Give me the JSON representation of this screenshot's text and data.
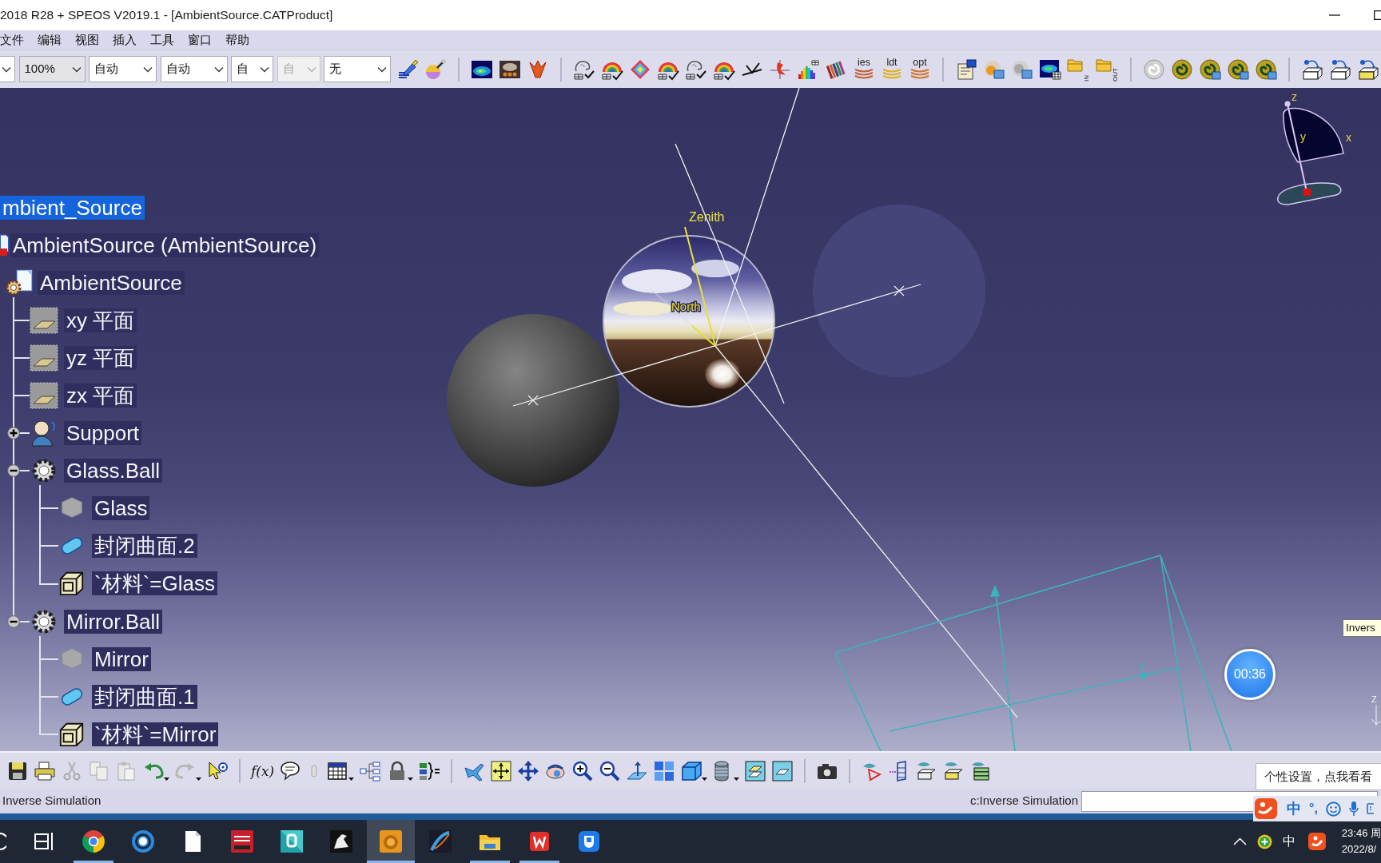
{
  "window": {
    "title": "2018 R28 + SPEOS V2019.1 - [AmbientSource.CATProduct]"
  },
  "menu": [
    "文件",
    "编辑",
    "视图",
    "插入",
    "工具",
    "窗口",
    "帮助"
  ],
  "toolbar": {
    "combos": [
      {
        "kind": "list",
        "disabled": false
      },
      {
        "kind": "editable",
        "value": "100%",
        "disabled": false
      },
      {
        "kind": "list",
        "value": "自动",
        "disabled": false
      },
      {
        "kind": "list",
        "value": "自动",
        "disabled": false
      },
      {
        "kind": "list",
        "value": "自",
        "disabled": false
      },
      {
        "kind": "list",
        "value": "自",
        "disabled": true
      },
      {
        "kind": "list",
        "value": "无",
        "disabled": false
      }
    ],
    "format_buttons": [
      {
        "label": "ies",
        "color": "#c4603a"
      },
      {
        "label": "ldt",
        "color": "#e0b020"
      },
      {
        "label": "opt",
        "color": "#d2762e"
      }
    ],
    "folder_buttons": [
      "IN",
      "OUT"
    ]
  },
  "tree": [
    {
      "label": "mbient_Source",
      "selected": true,
      "children": [
        {
          "label": "AmbientSource (AmbientSource)",
          "kind": "product",
          "selected": false,
          "children": [
            {
              "label": "AmbientSource",
              "kind": "part",
              "selected": false,
              "children": [
                {
                  "label": "xy 平面",
                  "kind": "plane",
                  "selected": false
                },
                {
                  "label": "yz 平面",
                  "kind": "plane",
                  "selected": false
                },
                {
                  "label": "zx 平面",
                  "kind": "plane",
                  "selected": false
                },
                {
                  "label": "Support",
                  "kind": "support",
                  "selected": false,
                  "expanded": false
                },
                {
                  "label": "Glass.Ball",
                  "kind": "body",
                  "selected": false,
                  "expanded": true,
                  "children": [
                    {
                      "label": "Glass",
                      "kind": "material",
                      "selected": false
                    },
                    {
                      "label": "封闭曲面.2",
                      "kind": "surface",
                      "selected": false
                    },
                    {
                      "label": "`材料`=Glass",
                      "kind": "parameter",
                      "selected": false
                    }
                  ]
                },
                {
                  "label": "Mirror.Ball",
                  "kind": "body",
                  "selected": false,
                  "expanded": true,
                  "children": [
                    {
                      "label": "Mirror",
                      "kind": "material",
                      "selected": false
                    },
                    {
                      "label": "封闭曲面.1",
                      "kind": "surface",
                      "selected": false
                    },
                    {
                      "label": "`材料`=Mirror",
                      "kind": "parameter",
                      "selected": false
                    }
                  ]
                }
              ]
            }
          ]
        }
      ]
    }
  ],
  "viewport": {
    "zenith_label": "Zenith",
    "north_label": "North",
    "compass": {
      "z_label": "z",
      "x_label": "x",
      "y_label": "y"
    },
    "wireframe_axis_label": "x",
    "mini_axis_label": "Z",
    "timer": "00:36",
    "tooltip": "Invers"
  },
  "bottom_toolbar": {
    "formula_button": "f(x)"
  },
  "status_bar": {
    "message": "Inverse Simulation",
    "command_label": "c:Inverse Simulation"
  },
  "ime": {
    "tooltip": "个性设置，点我看看",
    "mode": "中",
    "punctuation": "°,"
  },
  "taskbar": {
    "apps": [
      {
        "kind": "pinwheel",
        "running": true,
        "selected": false
      },
      {
        "kind": "ring",
        "running": false,
        "selected": false
      },
      {
        "kind": "page",
        "running": false,
        "selected": false
      },
      {
        "kind": "redtile",
        "running": false,
        "selected": false
      },
      {
        "kind": "tealtile",
        "running": false,
        "selected": false
      },
      {
        "kind": "blacktile",
        "running": false,
        "selected": false
      },
      {
        "kind": "orangedisc",
        "running": true,
        "selected": true
      },
      {
        "kind": "darktile",
        "running": false,
        "selected": false
      },
      {
        "kind": "folder",
        "running": true,
        "selected": false
      },
      {
        "kind": "redw",
        "running": true,
        "selected": false
      },
      {
        "kind": "bluetile",
        "running": false,
        "selected": false
      }
    ],
    "tray": {
      "ime_indicator": "中",
      "time": "23:46 周",
      "date": "2022/8/"
    }
  }
}
